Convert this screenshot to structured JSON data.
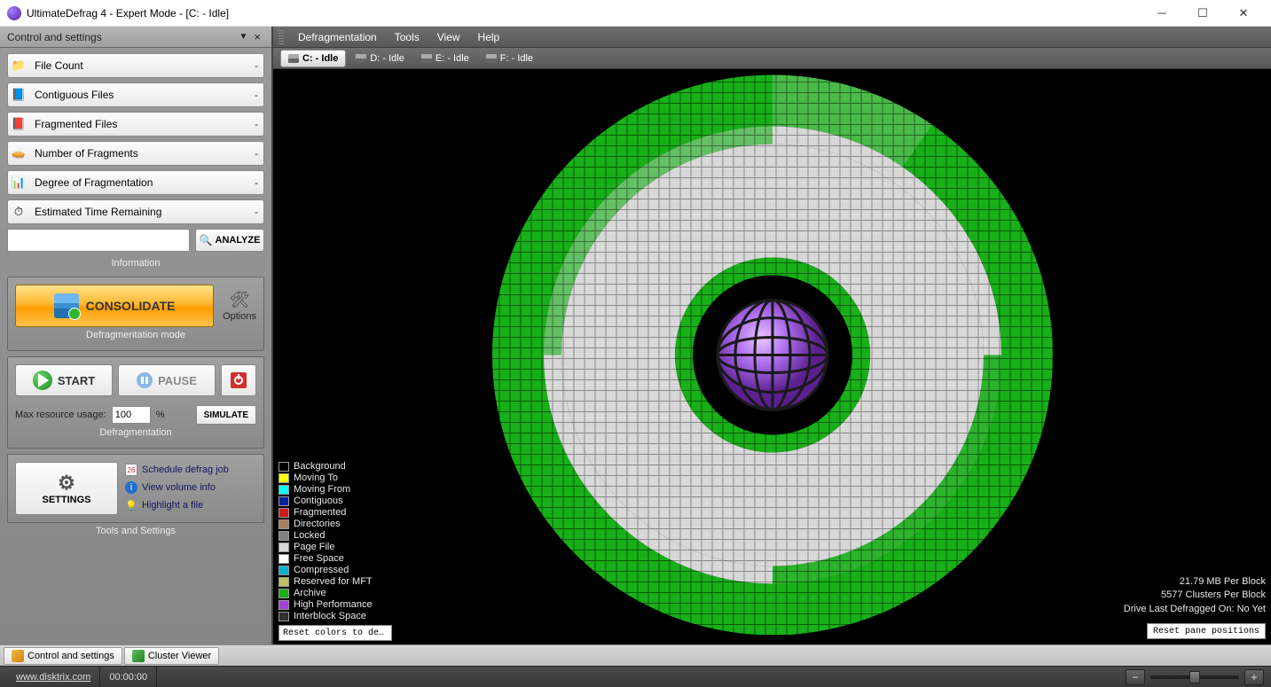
{
  "window": {
    "title": "UltimateDefrag 4 - Expert Mode - [C: - Idle]"
  },
  "sidebar": {
    "header_title": "Control and settings",
    "info_items": [
      {
        "label": "File Count",
        "value": "-"
      },
      {
        "label": "Contiguous Files",
        "value": "-"
      },
      {
        "label": "Fragmented Files",
        "value": "-"
      },
      {
        "label": "Number of Fragments",
        "value": "-"
      },
      {
        "label": "Degree of Fragmentation",
        "value": "-"
      },
      {
        "label": "Estimated Time Remaining",
        "value": "-"
      }
    ],
    "analyze_value": "",
    "analyze_label": "ANALYZE",
    "information_title": "Information",
    "consolidate_label": "CONSOLIDATE",
    "options_label": "Options",
    "defrag_mode_title": "Defragmentation mode",
    "start_label": "START",
    "pause_label": "PAUSE",
    "resource_label": "Max resource usage:",
    "resource_value": "100",
    "resource_unit": "%",
    "simulate_label": "SIMULATE",
    "defrag_title": "Defragmentation",
    "settings_label": "SETTINGS",
    "schedule_link": "Schedule defrag job",
    "volinfo_link": "View volume info",
    "highlight_link": "Highlight a file",
    "tools_title": "Tools and Settings"
  },
  "menubar": [
    "Defragmentation",
    "Tools",
    "View",
    "Help"
  ],
  "drives": [
    {
      "label": "C: - Idle",
      "active": true
    },
    {
      "label": "D: - Idle",
      "active": false
    },
    {
      "label": "E: - Idle",
      "active": false
    },
    {
      "label": "F: - Idle",
      "active": false
    }
  ],
  "legend": [
    {
      "label": "Background",
      "color": "#000000"
    },
    {
      "label": "Moving To",
      "color": "#ffff00"
    },
    {
      "label": "Moving From",
      "color": "#00ffff"
    },
    {
      "label": "Contiguous",
      "color": "#0020a0"
    },
    {
      "label": "Fragmented",
      "color": "#d01818"
    },
    {
      "label": "Directories",
      "color": "#a88060"
    },
    {
      "label": "Locked",
      "color": "#808080"
    },
    {
      "label": "Page File",
      "color": "#d8d8d8"
    },
    {
      "label": "Free Space",
      "color": "#ffffff"
    },
    {
      "label": "Compressed",
      "color": "#00b0d0"
    },
    {
      "label": "Reserved for MFT",
      "color": "#c0c060"
    },
    {
      "label": "Archive",
      "color": "#18b018"
    },
    {
      "label": "High Performance",
      "color": "#a040e0"
    },
    {
      "label": "Interblock Space",
      "color": "#303030"
    }
  ],
  "reset_colors_label": "Reset colors to de…",
  "reset_pane_label": "Reset pane positions",
  "stats": {
    "mb_per_block": "21.79 MB Per Block",
    "clusters_per_block": "5577 Clusters Per Block",
    "last_defrag": "Drive Last Defragged On: No Yet"
  },
  "bottom_tabs": [
    {
      "label": "Control and settings"
    },
    {
      "label": "Cluster Viewer"
    }
  ],
  "statusbar": {
    "url": "www.disktrix.com",
    "time": "00:00:00"
  }
}
